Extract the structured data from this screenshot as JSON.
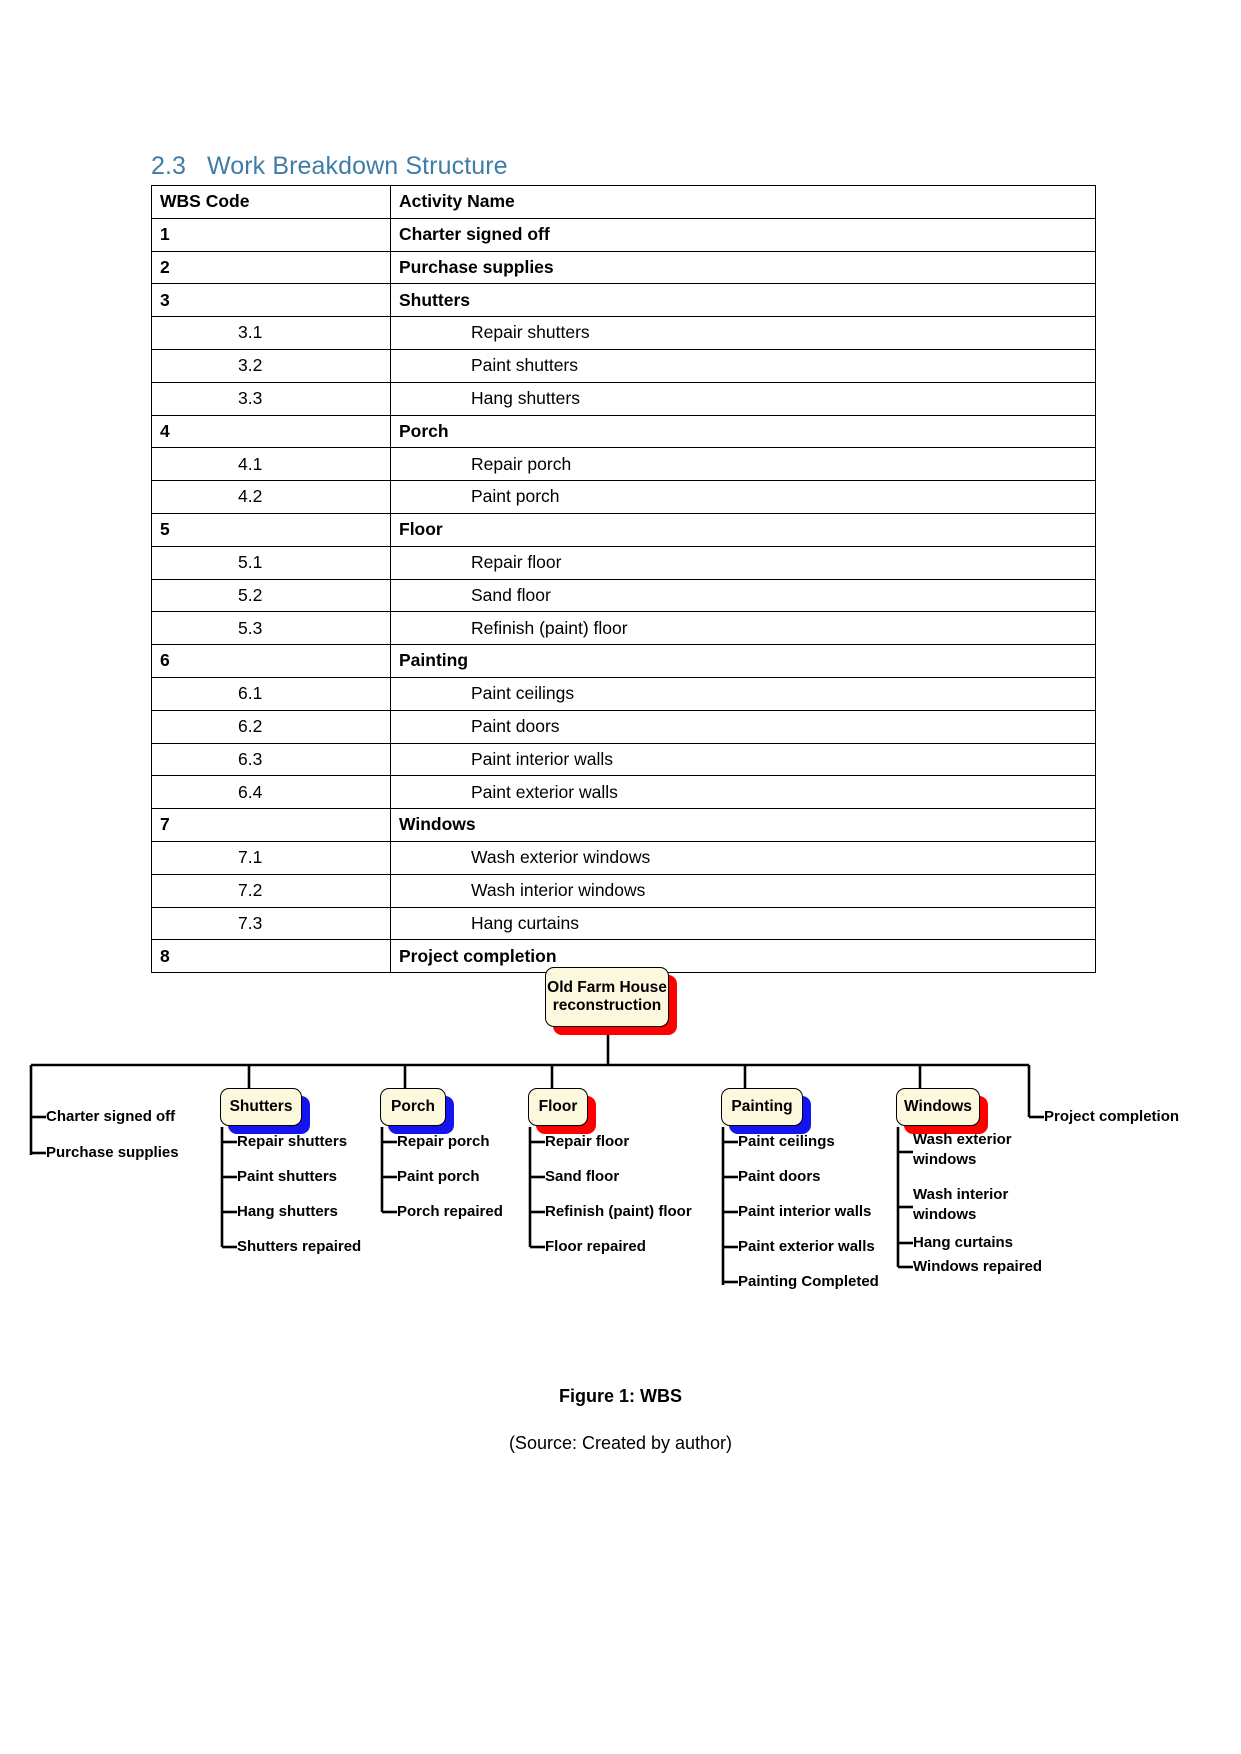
{
  "heading": {
    "number": "2.3",
    "title": "Work Breakdown Structure"
  },
  "table": {
    "headers": {
      "code": "WBS Code",
      "name": "Activity Name"
    },
    "rows": [
      {
        "code": "1",
        "name": "Charter signed off",
        "level": 1
      },
      {
        "code": "2",
        "name": "Purchase supplies",
        "level": 1
      },
      {
        "code": "3",
        "name": "Shutters",
        "level": 1
      },
      {
        "code": "3.1",
        "name": "Repair shutters",
        "level": 2
      },
      {
        "code": "3.2",
        "name": "Paint shutters",
        "level": 2
      },
      {
        "code": "3.3",
        "name": "Hang shutters",
        "level": 2
      },
      {
        "code": "4",
        "name": "Porch",
        "level": 1
      },
      {
        "code": "4.1",
        "name": "Repair porch",
        "level": 2
      },
      {
        "code": "4.2",
        "name": "Paint porch",
        "level": 2
      },
      {
        "code": "5",
        "name": "Floor",
        "level": 1
      },
      {
        "code": "5.1",
        "name": "Repair floor",
        "level": 2
      },
      {
        "code": "5.2",
        "name": "Sand floor",
        "level": 2
      },
      {
        "code": "5.3",
        "name": "Refinish (paint) floor",
        "level": 2
      },
      {
        "code": "6",
        "name": "Painting",
        "level": 1
      },
      {
        "code": "6.1",
        "name": "Paint ceilings",
        "level": 2
      },
      {
        "code": "6.2",
        "name": "Paint doors",
        "level": 2
      },
      {
        "code": "6.3",
        "name": "Paint interior walls",
        "level": 2
      },
      {
        "code": "6.4",
        "name": "Paint exterior walls",
        "level": 2
      },
      {
        "code": "7",
        "name": "Windows",
        "level": 1
      },
      {
        "code": "7.1",
        "name": "Wash exterior windows",
        "level": 2
      },
      {
        "code": "7.2",
        "name": "Wash interior windows",
        "level": 2
      },
      {
        "code": "7.3",
        "name": "Hang curtains",
        "level": 2
      },
      {
        "code": "8",
        "name": "Project completion",
        "level": 1
      }
    ]
  },
  "diagram": {
    "root": {
      "label": "Old Farm House\nreconstruction",
      "shadow_color": "#fd0000"
    },
    "left_branch": [
      {
        "label": "Charter signed off"
      },
      {
        "label": "Purchase supplies"
      }
    ],
    "right_branch": [
      {
        "label": "Project completion"
      }
    ],
    "branches": [
      {
        "label": "Shutters",
        "shadow_color": "#1414f0",
        "children": [
          {
            "label": "Repair shutters"
          },
          {
            "label": "Paint shutters"
          },
          {
            "label": "Hang shutters"
          },
          {
            "label": "Shutters repaired"
          }
        ]
      },
      {
        "label": "Porch",
        "shadow_color": "#1414f0",
        "children": [
          {
            "label": "Repair porch"
          },
          {
            "label": "Paint porch"
          },
          {
            "label": "Porch repaired"
          }
        ]
      },
      {
        "label": "Floor",
        "shadow_color": "#fd0000",
        "children": [
          {
            "label": "Repair floor"
          },
          {
            "label": "Sand floor"
          },
          {
            "label": "Refinish (paint) floor"
          },
          {
            "label": "Floor repaired"
          }
        ]
      },
      {
        "label": "Painting",
        "shadow_color": "#1414f0",
        "children": [
          {
            "label": "Paint ceilings"
          },
          {
            "label": "Paint doors"
          },
          {
            "label": "Paint interior walls"
          },
          {
            "label": "Paint exterior walls"
          },
          {
            "label": "Painting Completed"
          }
        ]
      },
      {
        "label": "Windows",
        "shadow_color": "#fd0000",
        "children": [
          {
            "label": "Wash exterior\nwindows"
          },
          {
            "label": "Wash interior\nwindows"
          },
          {
            "label": "Hang curtains"
          },
          {
            "label": "Windows repaired"
          }
        ]
      }
    ]
  },
  "captions": {
    "figure": "Figure 1: WBS",
    "source": "(Source: Created by author)"
  },
  "colors": {
    "heading": "#3f7ca8",
    "node_fill": "#fbf8dd",
    "shadow_red": "#fd0000",
    "shadow_blue": "#1414f0",
    "line": "#000000"
  }
}
